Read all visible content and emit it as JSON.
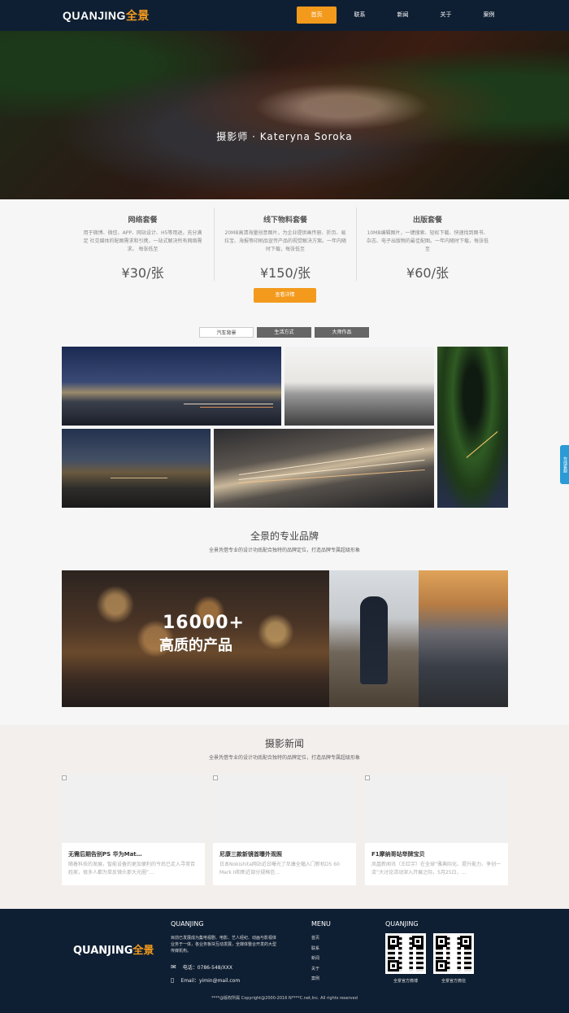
{
  "header": {
    "logo_main": "QUANJING",
    "logo_cn": "全景",
    "nav": [
      {
        "label": "首页",
        "active": true
      },
      {
        "label": "联系",
        "active": false
      },
      {
        "label": "新闻",
        "active": false
      },
      {
        "label": "关于",
        "active": false
      },
      {
        "label": "案例",
        "active": false
      }
    ]
  },
  "hero": {
    "caption": "摄影师 · Kateryna Soroka"
  },
  "packages": [
    {
      "title": "网络套餐",
      "desc": "用于微博、微信、APP、网站设计、H5等用途，充分满足 社交媒体的配图需求和引携，一站式解决所有网络需求。 每张低至",
      "price": "¥30/张"
    },
    {
      "title": "线下物料套餐",
      "desc": "20MB高清海量创意图片，为企业提供画传册、折页、易拉宝、海报等印刷品宣传产品的视觉解决方案。一年内随时下载，每张低至",
      "price": "¥150/张"
    },
    {
      "title": "出版套餐",
      "desc": "10MB编辑图片，一键搜索、轻松下载、快速找到图书、杂志、电子出版物的最佳配图。一年内随时下载，每张低至",
      "price": "¥60/张"
    }
  ],
  "more_button": "查看详情",
  "gallery_tabs": [
    {
      "label": "汽车背景",
      "active": true
    },
    {
      "label": "生活方式",
      "active": false
    },
    {
      "label": "大师作品",
      "active": false
    }
  ],
  "brand": {
    "title": "全景的专业品牌",
    "subtitle": "全景凭借专业的设计功底配合独特的品牌定位，打造品牌专属超级形象",
    "number": "16000+",
    "label": "高质的产品"
  },
  "news": {
    "title": "摄影新闻",
    "subtitle": "全景凭借专业的设计功底配合独特的品牌定位，打造品牌专属超级形象",
    "items": [
      {
        "title": "无需后期告别PS 华为Mat…",
        "body": "随着科技的发展，智能设备的更加便利的今后已走入寻常百姓家，很多人都为单反镜头那大光圈”…"
      },
      {
        "title": "尼康三款新镜首曝外观照",
        "body": "日本Nokishita网站近日曝光了尼康全幅入门新机D5 60 Mark II和新近部分规格信…"
      },
      {
        "title": "F1摩纳哥站举牌宝贝",
        "body": "凤凰新闻讯（王红宇）在全球“雅典际化、提升能力、争创一流”大讨论活动深入开展之际，5月25日，…"
      }
    ]
  },
  "footer": {
    "logo_main": "QUANJING",
    "logo_cn": "全景",
    "about_heading": "QUANJING",
    "about_text": "目前已发展成为集电视剧、电影、艺人经纪、动画与影视体业务于一体，各业务板块互动发展，全媒体整合开发的大型传媒机构。",
    "phone": "电话：0786-548/XXX",
    "email": "Email：yimin@mail.com",
    "menu_heading": "MENU",
    "menu_items": [
      "首页",
      "联系",
      "新闻",
      "关于",
      "案例"
    ],
    "qr_heading": "QUANJING",
    "qr_captions": [
      "全景官方微博",
      "全景官方微信"
    ],
    "copyright": "****@版权所属 Copyright@2000-2016 N****C.net,Inc.   All rights reserved"
  },
  "side_tab": "在线客服"
}
